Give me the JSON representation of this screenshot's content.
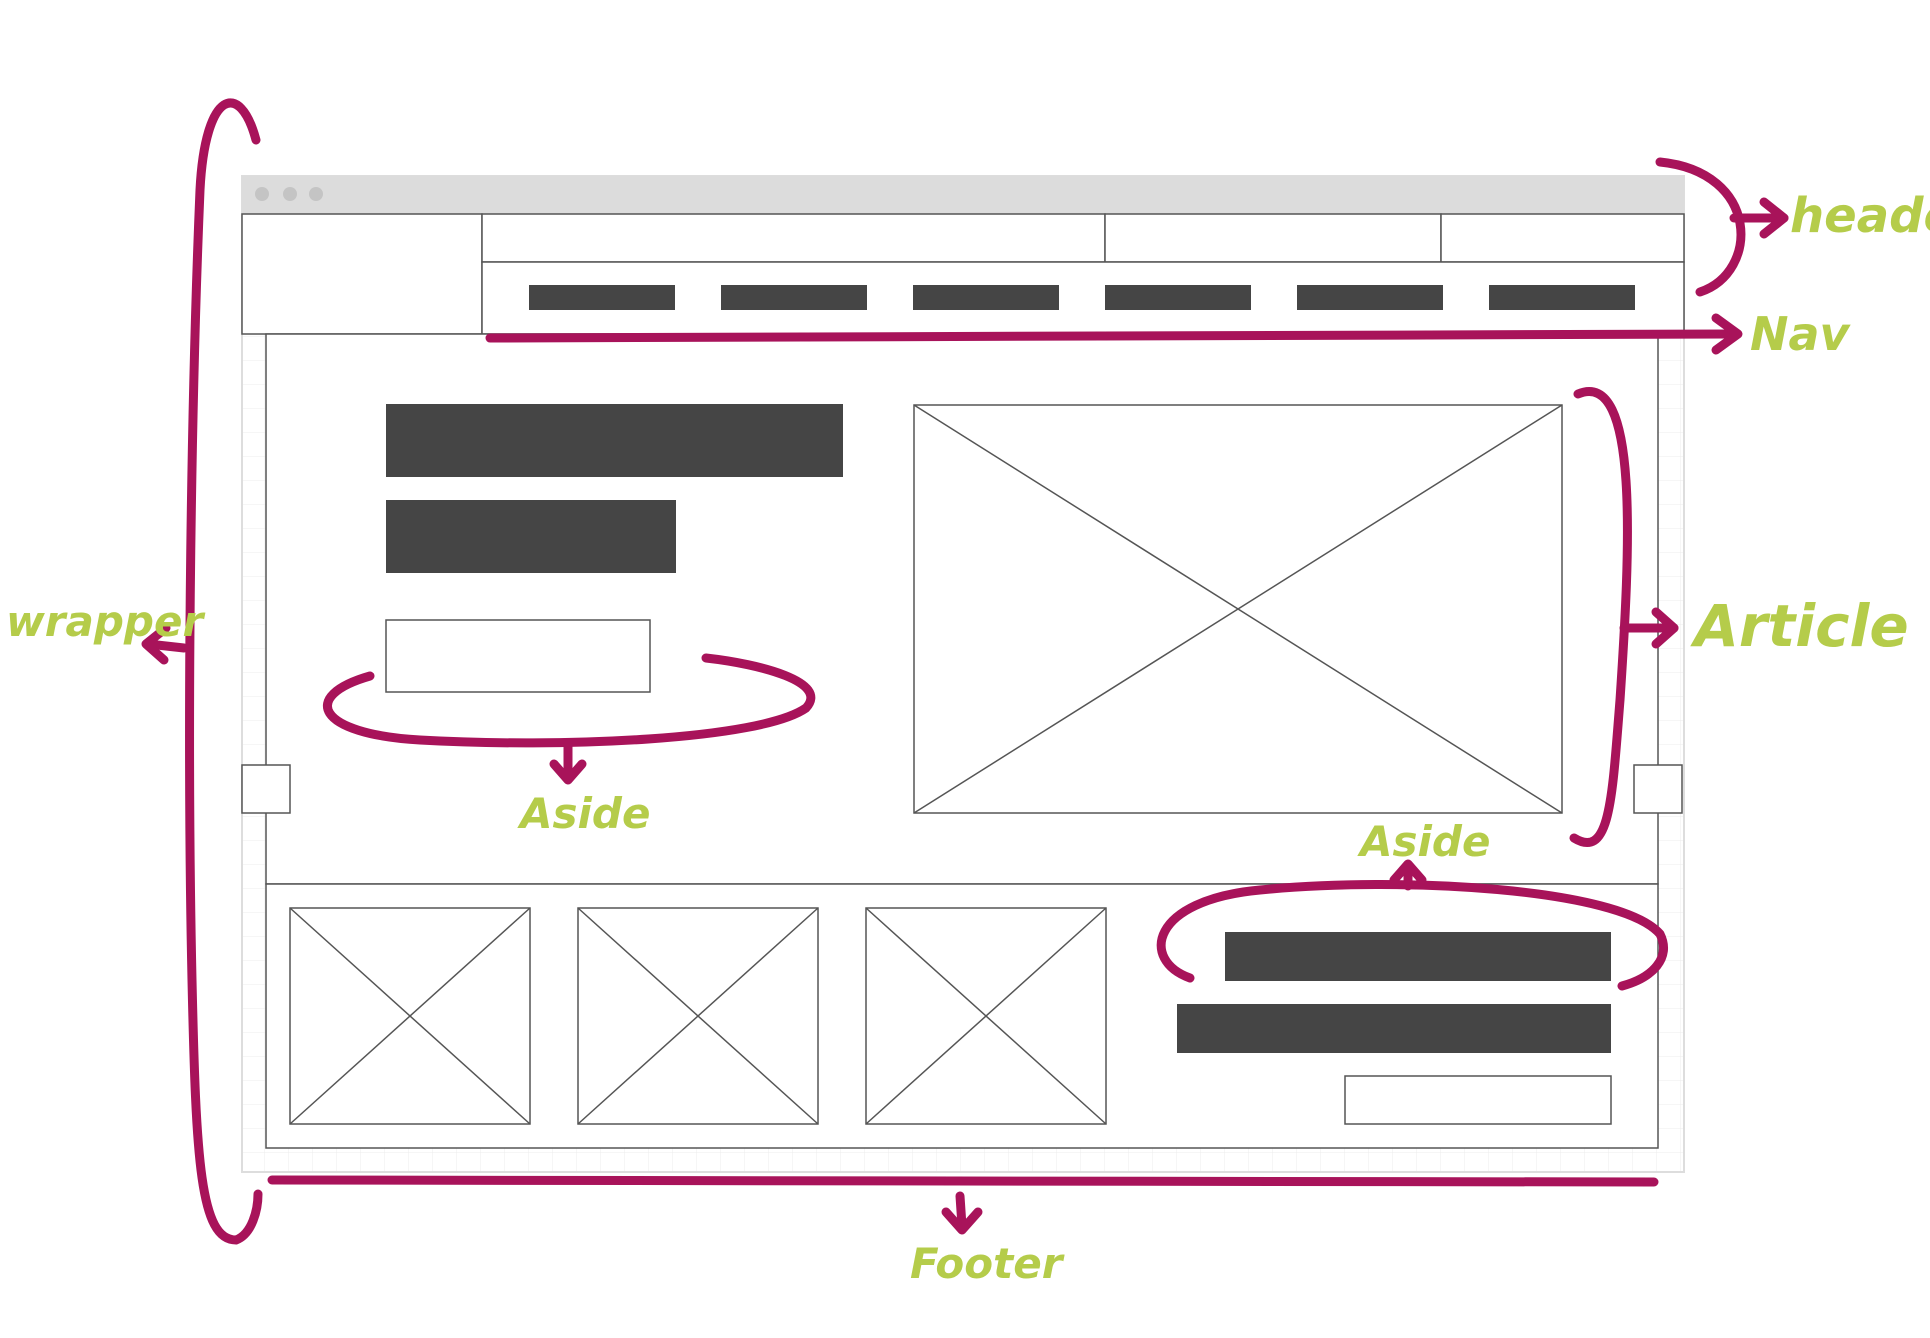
{
  "colors": {
    "annotation_stroke": "#a8135a",
    "annotation_text": "#b5cc4a",
    "block_fill": "#454545",
    "outline": "#555555",
    "grid_line": "#ececec",
    "browser_bar": "#dcdcdc",
    "browser_dot": "#c4c4c4"
  },
  "annotations": {
    "header": "header",
    "nav": "Nav",
    "article": "Article",
    "wrapper": "wrapper",
    "aside_left": "Aside",
    "aside_right": "Aside",
    "footer": "Footer"
  },
  "wireframe": {
    "browser_dots": 3,
    "nav_item_count": 6,
    "gallery_image_count": 3
  }
}
